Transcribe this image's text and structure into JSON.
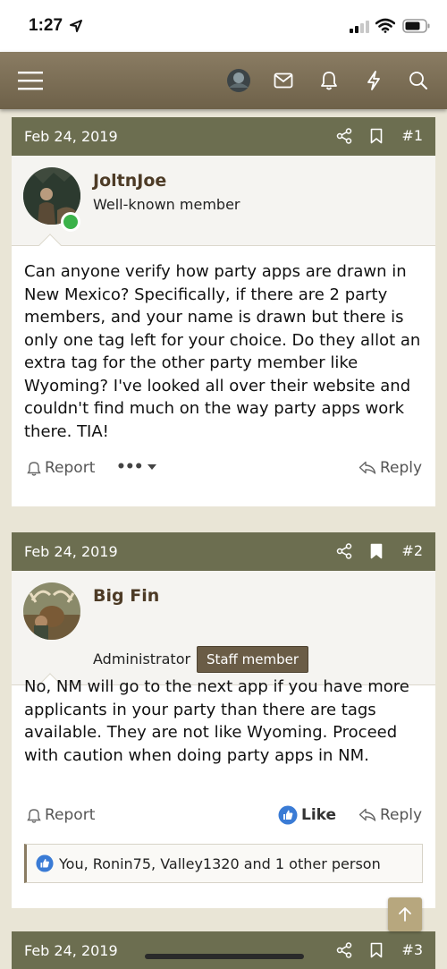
{
  "status": {
    "time": "1:27"
  },
  "navbar": {
    "icons": [
      "menu-icon",
      "avatar",
      "mail-icon",
      "bell-icon",
      "lightning-icon",
      "search-icon"
    ]
  },
  "posts": [
    {
      "date": "Feb 24, 2019",
      "number": "#1",
      "user": {
        "name": "JoltnJoe",
        "title": "Well-known member",
        "online": true
      },
      "body": "Can anyone verify how party apps are drawn in New Mexico? Specifically, if there are 2 party members, and your name is drawn but there is only one tag left for your choice. Do they allot an extra tag for the other party member like Wyoming? I've looked all over their website and couldn't find much on the way party apps work there. TIA!",
      "actions": {
        "report": "Report",
        "more": "•••",
        "reply": "Reply"
      }
    },
    {
      "date": "Feb 24, 2019",
      "number": "#2",
      "bookmarked": true,
      "user": {
        "name": "Big Fin",
        "title": "Administrator",
        "badge": "Staff member"
      },
      "body": "No, NM will go to the next app if you have more applicants in your party than there are tags available. They are not like Wyoming. Proceed with caution when doing party apps in NM.",
      "actions": {
        "report": "Report",
        "like": "Like",
        "reply": "Reply"
      },
      "reactions": "You, Ronin75, Valley1320 and 1 other person"
    },
    {
      "date": "Feb 24, 2019",
      "number": "#3"
    }
  ],
  "colors": {
    "navbar": "#7d6f57",
    "post_header": "#6c6e50",
    "username": "#4d3b26",
    "like_blue": "#3a7bd5",
    "online_green": "#3bb24a"
  }
}
